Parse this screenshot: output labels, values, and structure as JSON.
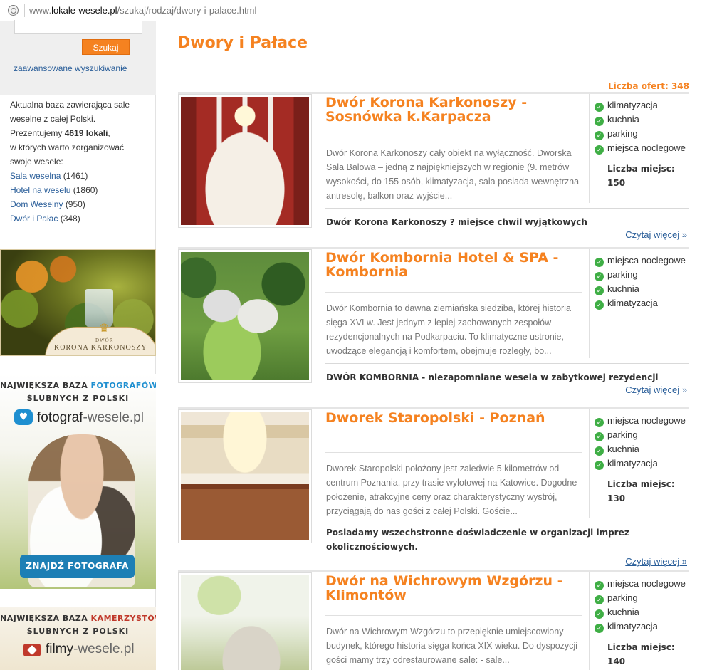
{
  "browser": {
    "url_prefix": "www.",
    "url_domain": "lokale-wesele.pl",
    "url_path": "/szukaj/rodzaj/dwory-i-palace.html"
  },
  "sidebar": {
    "search_button": "Szukaj",
    "advanced_link": "zaawansowane wyszukiwanie",
    "info_line1": "Aktualna baza zawierająca sale",
    "info_line2": "weselne z całej Polski.",
    "info_line3_prefix": "Prezentujemy ",
    "info_count": "4619 lokali",
    "info_line3_suffix": ",",
    "info_line4": "w których warto zorganizować",
    "info_line5": "swoje wesele:",
    "categories": [
      {
        "label": "Sala weselna",
        "count": "(1461)"
      },
      {
        "label": "Hotel na weselu",
        "count": "(1860)"
      },
      {
        "label": "Dom Weselny",
        "count": "(950)"
      },
      {
        "label": "Dwór i Pałac",
        "count": "(348)"
      }
    ]
  },
  "banners": {
    "korona": {
      "small": "DWÓR",
      "brand": "KORONA KARKONOSZY"
    },
    "fotograf": {
      "line1_prefix": "NAJWIĘKSZA BAZA ",
      "line1_highlight": "FOTOGRAFÓW",
      "line2": "ŚLUBNYCH Z POLSKI",
      "site_name": "fotograf",
      "site_suffix": "-wesele.pl",
      "cta": "ZNAJDŹ FOTOGRAFA"
    },
    "filmy": {
      "line1_prefix": "NAJWIĘKSZA BAZA ",
      "line1_highlight": "KAMERZYSTÓW",
      "line2": "ŚLUBNYCH Z POLSKI",
      "site_name": "filmy",
      "site_suffix": "-wesele.pl"
    }
  },
  "main": {
    "title": "Dwory i Pałace",
    "offers_label": "Liczba ofert: 348",
    "listings": [
      {
        "title": "Dwór Korona Karkonoszy - Sosnówka k.Karpacza",
        "desc": "Dwór Korona Karkonoszy cały obiekt na wyłączność. Dworska Sala Balowa – jedną z najpiękniejszych w regionie (9. metrów wysokości, do 155 osób, klimatyzacja, sala posiada wewnętrzna antresolę, balkon oraz wyjście...",
        "features": [
          "klimatyzacja",
          "kuchnia",
          "parking",
          "miejsca noclegowe"
        ],
        "capacity_label": "Liczba miejsc:",
        "capacity": "150",
        "slogan": "Dwór Korona Karkonoszy ? miejsce chwil wyjątkowych",
        "more": "Czytaj więcej »"
      },
      {
        "title": "Dwór Kombornia Hotel & SPA - Kombornia",
        "desc": "Dwór Kombornia to dawna ziemiańska siedziba, której historia sięga XVI w. Jest jednym z lepiej zachowanych zespołów rezydencjonalnych na Podkarpaciu. To klimatyczne ustronie, uwodzące elegancją i komfortem, obejmuje rozległy, bo...",
        "features": [
          "miejsca noclegowe",
          "parking",
          "kuchnia",
          "klimatyzacja"
        ],
        "capacity_label": "",
        "capacity": "",
        "slogan": "DWÓR KOMBORNIA - niezapomniane wesela w zabytkowej rezydencji",
        "more": "Czytaj więcej »"
      },
      {
        "title": "Dworek Staropolski - Poznań",
        "desc": "Dworek Staropolski położony jest zaledwie 5 kilometrów od centrum Poznania, przy trasie wylotowej na Katowice. Dogodne położenie, atrakcyjne ceny oraz charakterystyczny wystrój, przyciągają do nas gości z całej Polski. Goście...",
        "features": [
          "miejsca noclegowe",
          "parking",
          "kuchnia",
          "klimatyzacja"
        ],
        "capacity_label": "Liczba miejsc:",
        "capacity": "130",
        "slogan": "Posiadamy wszechstronne doświadczenie w organizacji imprez okolicznościowych.",
        "more": "Czytaj więcej »"
      },
      {
        "title": "Dwór na Wichrowym Wzgórzu - Klimontów",
        "desc": "Dwór na Wichrowym Wzgórzu to przepięknie umiejscowiony budynek, którego historia sięga końca XIX wieku. Do dyspozycji gości mamy trzy odrestaurowane sale: - sale...",
        "features": [
          "miejsca noclegowe",
          "parking",
          "kuchnia",
          "klimatyzacja"
        ],
        "capacity_label": "Liczba miejsc:",
        "capacity": "140",
        "slogan": "",
        "more": ""
      }
    ]
  }
}
